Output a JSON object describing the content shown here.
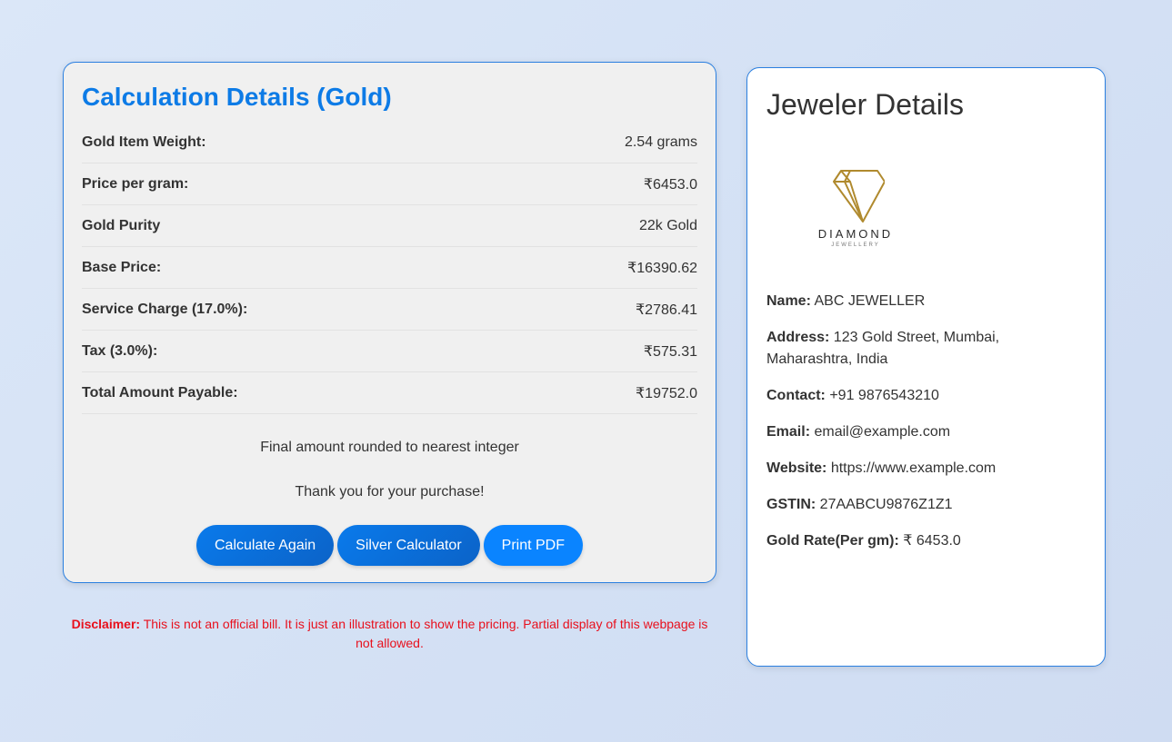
{
  "calc": {
    "title": "Calculation Details (Gold)",
    "rows": [
      {
        "label": "Gold Item Weight:",
        "value": "2.54 grams"
      },
      {
        "label": "Price per gram:",
        "value": "₹6453.0"
      },
      {
        "label": "Gold Purity",
        "value": "22k Gold"
      },
      {
        "label": "Base Price:",
        "value": "₹16390.62"
      },
      {
        "label": "Service Charge (17.0%):",
        "value": "₹2786.41"
      },
      {
        "label": "Tax (3.0%):",
        "value": "₹575.31"
      },
      {
        "label": "Total Amount Payable:",
        "value": "₹19752.0"
      }
    ],
    "note_rounding": "Final amount rounded to nearest integer",
    "note_thanks": "Thank you for your purchase!",
    "buttons": {
      "calculate_again": "Calculate Again",
      "silver_calculator": "Silver Calculator",
      "print_pdf": "Print PDF"
    }
  },
  "disclaimer": {
    "label": "Disclaimer:",
    "text": " This is not an official bill. It is just an illustration to show the pricing. Partial display of this webpage is not allowed."
  },
  "jeweler": {
    "title": "Jeweler Details",
    "logo": {
      "icon": "diamond-icon",
      "main_text": "DIAMOND",
      "sub_text": "JEWELLERY",
      "color": "#b08a2e"
    },
    "fields": [
      {
        "label": "Name:",
        "value": " ABC JEWELLER"
      },
      {
        "label": "Address:",
        "value": " 123 Gold Street, Mumbai, Maharashtra, India"
      },
      {
        "label": "Contact:",
        "value": " +91 9876543210"
      },
      {
        "label": "Email:",
        "value": " email@example.com"
      },
      {
        "label": "Website:",
        "value": " https://www.example.com"
      },
      {
        "label": "GSTIN:",
        "value": " 27AABCU9876Z1Z1"
      },
      {
        "label": "Gold Rate(Per gm):",
        "value": " ₹ 6453.0"
      }
    ]
  },
  "colors": {
    "accent": "#0d7be6",
    "border": "#2a7fe0",
    "disclaimer": "#e8101d"
  }
}
